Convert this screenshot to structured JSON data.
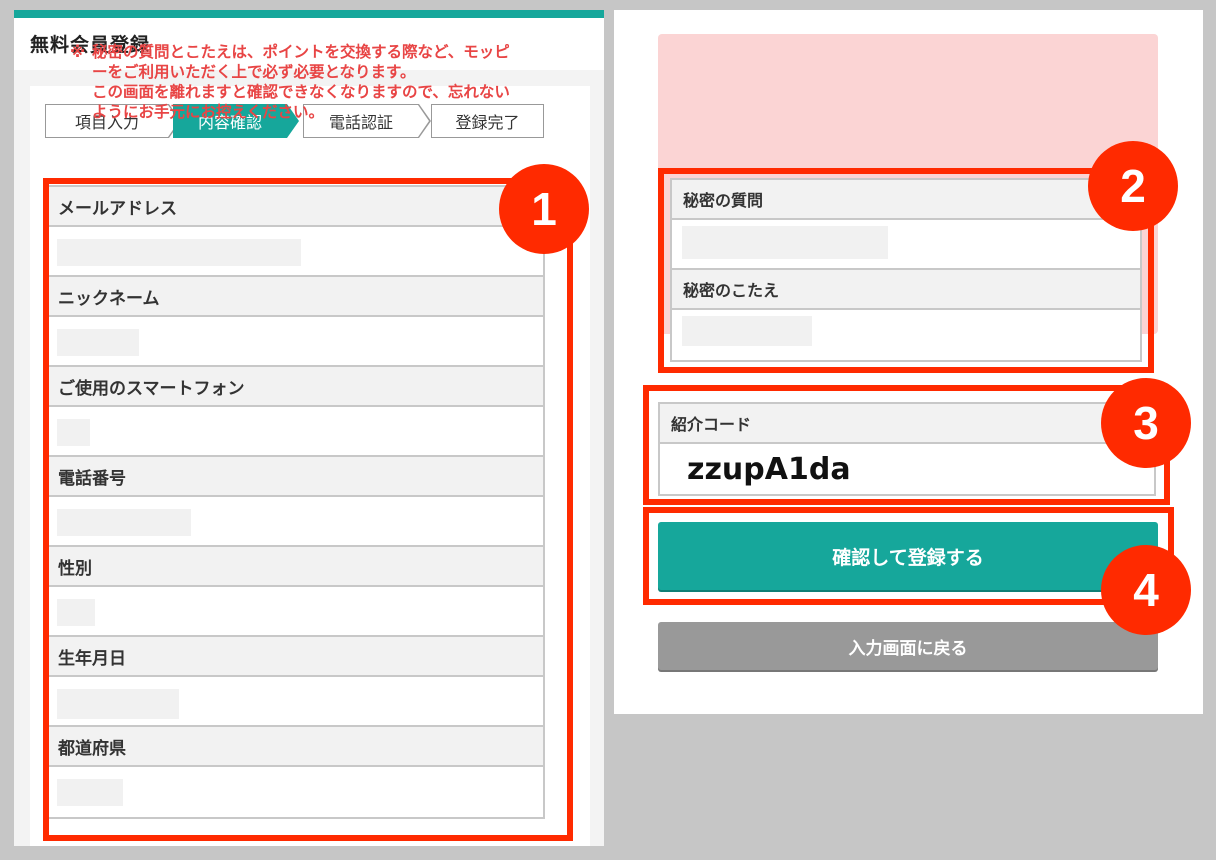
{
  "left": {
    "title": "無料会員登録",
    "steps": [
      "項目入力",
      "内容確認",
      "電話認証",
      "登録完了"
    ],
    "active_step": "内容確認",
    "fields": [
      {
        "label": "メールアドレス"
      },
      {
        "label": "ニックネーム"
      },
      {
        "label": "ご使用のスマートフォン"
      },
      {
        "label": "電話番号"
      },
      {
        "label": "性別"
      },
      {
        "label": "生年月日"
      },
      {
        "label": "都道府県"
      }
    ]
  },
  "right": {
    "warning_mark": "※",
    "warning_text": "秘密の質問とこたえは、ポイントを交換する際など、モッピーをご利用いただく上で必ず必要となります。\nこの画面を離れますと確認できなくなりますので、忘れないようにお手元にお控えください。",
    "secret_question_label": "秘密の質問",
    "secret_answer_label": "秘密のこたえ",
    "referral_label": "紹介コード",
    "referral_code": "zzupA1da",
    "confirm_button": "確認して登録する",
    "back_button": "入力画面に戻る"
  },
  "badges": [
    "1",
    "2",
    "3",
    "4"
  ],
  "colors": {
    "accent": "#16a79b",
    "highlight": "#ff2a00",
    "warning_bg": "#fbd4d4",
    "warning_text": "#e84545"
  }
}
